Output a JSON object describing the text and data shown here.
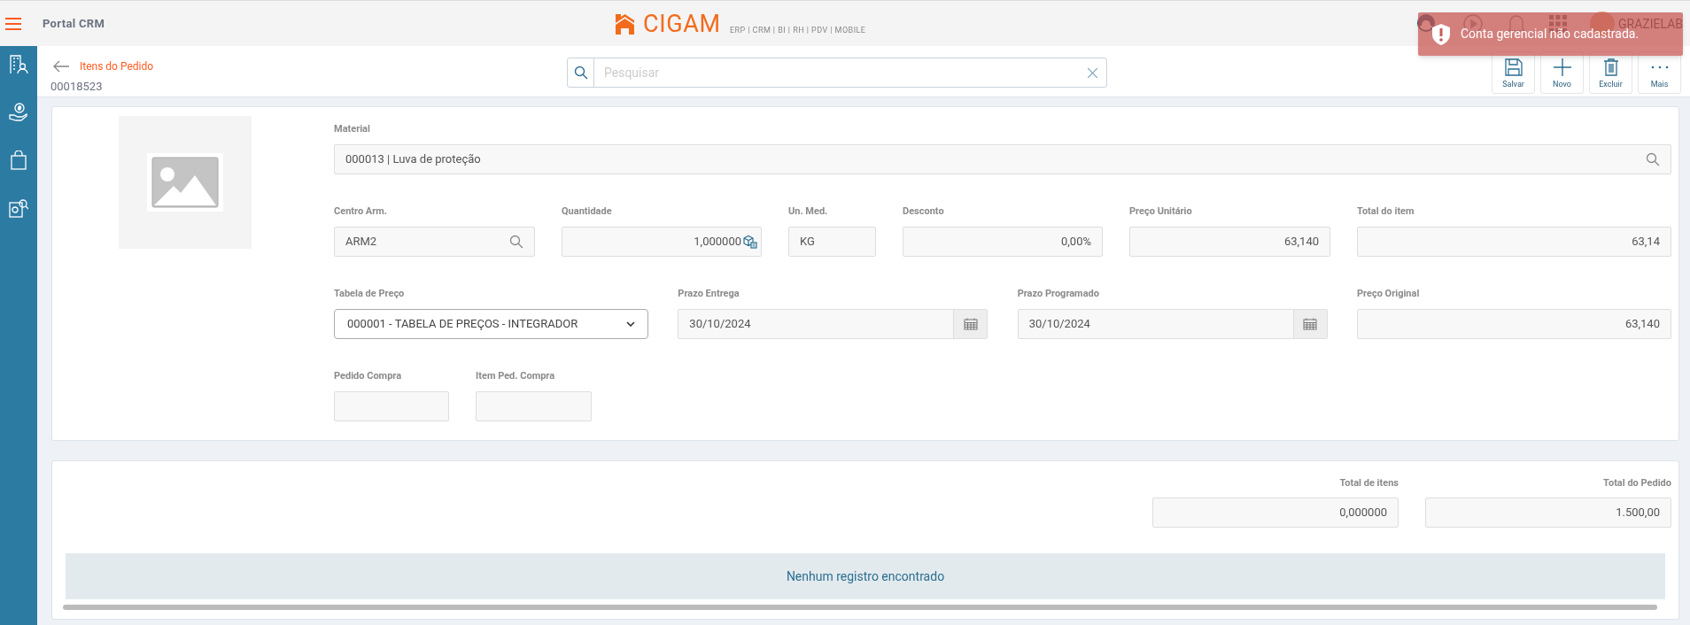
{
  "app_title": "Portal CRM",
  "logo": {
    "name": "CIGAM",
    "tagline": "ERP | CRM | BI | RH | PDV | MOBILE"
  },
  "user": {
    "name": "GRAZIELAB"
  },
  "toast": {
    "message": "Conta gerencial não cadastrada."
  },
  "page": {
    "title": "Itens do Pedido",
    "subtitle": "00018523"
  },
  "search": {
    "placeholder": "Pesquisar"
  },
  "actions": [
    {
      "label": "Salvar",
      "kind": "save"
    },
    {
      "label": "Novo",
      "kind": "new"
    },
    {
      "label": "Excluir",
      "kind": "delete"
    },
    {
      "label": "Mais",
      "kind": "more"
    }
  ],
  "form_rows": [
    [
      {
        "label": "Material",
        "value": "000013 | Luva de proteção",
        "kind": "lookup"
      }
    ],
    [
      {
        "label": "Centro Arm.",
        "value": "ARM2",
        "kind": "lookup"
      },
      {
        "label": "Quantidade",
        "value": "1,000000",
        "kind": "quantity"
      },
      {
        "label": "Un. Med.",
        "value": "KG",
        "kind": "text"
      },
      {
        "label": "Desconto",
        "value": "0,00%",
        "kind": "number"
      },
      {
        "label": "Preço Unitário",
        "value": "63,140",
        "kind": "number"
      },
      {
        "label": "Total do item",
        "value": "63,14",
        "kind": "number"
      }
    ],
    [
      {
        "label": "Tabela de Preço",
        "value": "000001 - TABELA DE PREÇOS - INTEGRADOR",
        "kind": "select"
      },
      {
        "label": "Prazo Entrega",
        "value": "30/10/2024",
        "kind": "date"
      },
      {
        "label": "Prazo Programado",
        "value": "30/10/2024",
        "kind": "date"
      },
      {
        "label": "Preço Original",
        "value": "63,140",
        "kind": "number"
      }
    ],
    [
      {
        "label": "Pedido Compra",
        "kind": "text"
      },
      {
        "label": "Item Ped. Compra",
        "kind": "text"
      }
    ]
  ],
  "totals": [
    {
      "label": "Total de itens",
      "value": "0,000000"
    },
    {
      "label": "Total do Pedido",
      "value": "1.500,00"
    }
  ],
  "empty_message": "Nenhum registro encontrado"
}
